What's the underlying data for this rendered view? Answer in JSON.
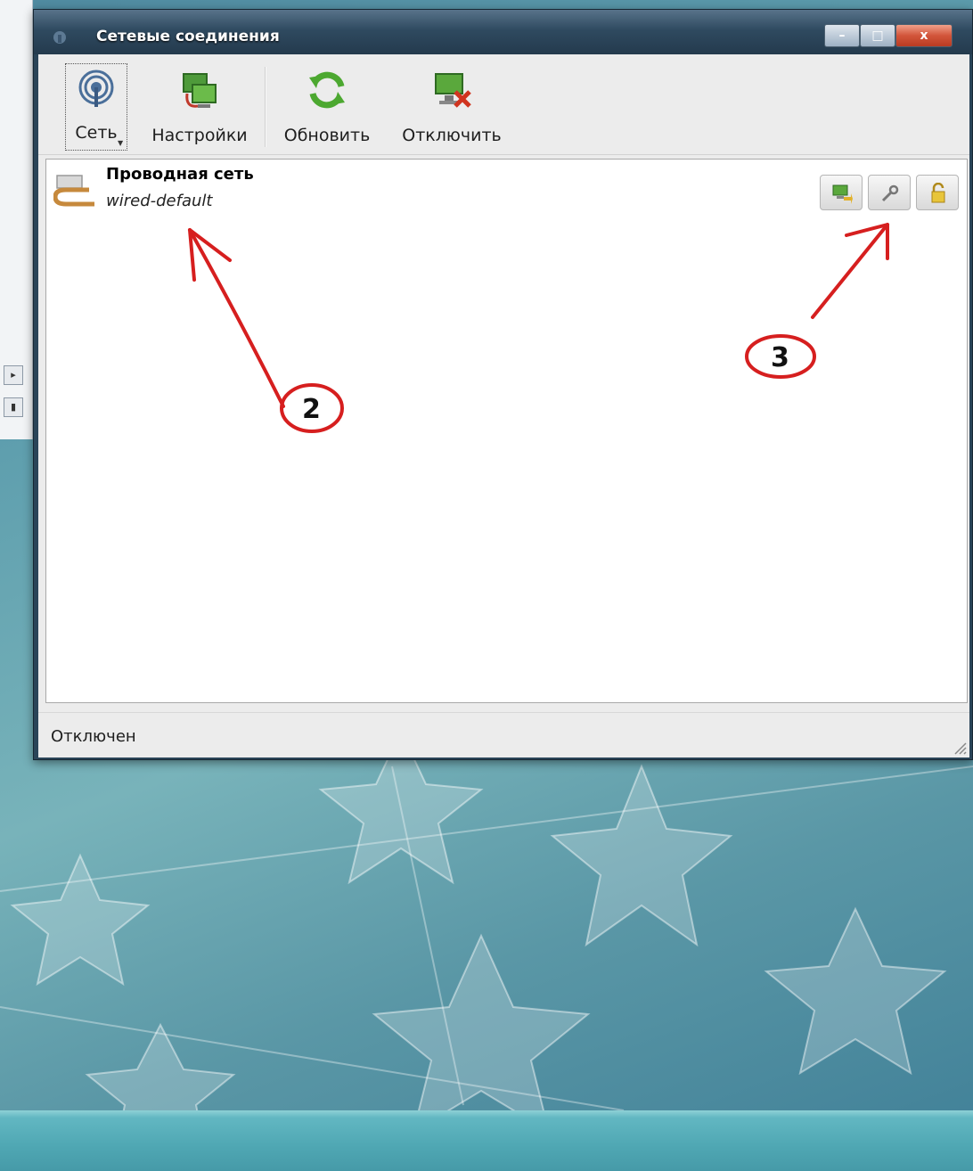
{
  "window": {
    "title": "Сетевые соединения",
    "controls": {
      "minimize": "–",
      "maximize": "□",
      "close": "x"
    }
  },
  "toolbar": {
    "network_label": "Сеть",
    "settings_label": "Настройки",
    "refresh_label": "Обновить",
    "disconnect_label": "Отключить"
  },
  "connection": {
    "name": "Проводная сеть",
    "profile": "wired-default",
    "actions": [
      "connect-icon",
      "wrench-icon",
      "lock-icon"
    ]
  },
  "statusbar": {
    "text": "Отключен"
  },
  "annotations": {
    "callout_2": "2",
    "callout_3": "3",
    "color": "#d61f1f"
  },
  "colors": {
    "titlebar": "#2f4a60",
    "annotation": "#d61f1f",
    "taskbar": "#4fa7b3"
  }
}
